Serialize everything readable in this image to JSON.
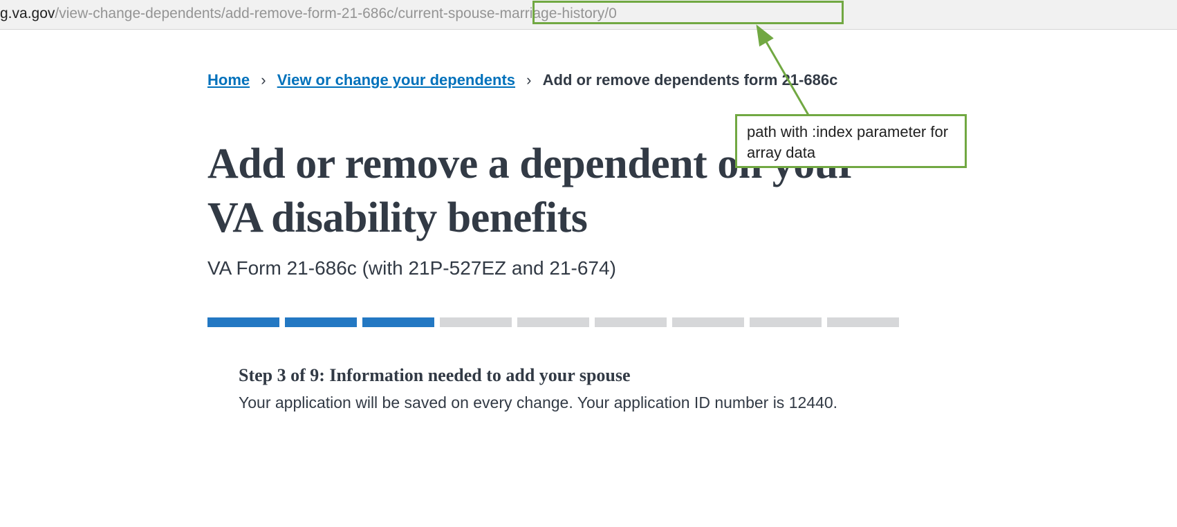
{
  "url": {
    "domain_part": "g.va.gov",
    "path_part": "/view-change-dependents/add-remove-form-21-686c/current-spouse-marriage-history/0"
  },
  "breadcrumbs": {
    "home": "Home",
    "level1": "View or change your dependents",
    "current": "Add or remove dependents form 21-686c",
    "separator": "›"
  },
  "page": {
    "title": "Add or remove a dependent on your VA disability benefits",
    "subtitle": "VA Form 21-686c (with 21P-527EZ and 21-674)"
  },
  "progress": {
    "total": 9,
    "completed": 3
  },
  "step": {
    "title": "Step 3 of 9: Information needed to add your spouse",
    "desc": "Your application will be saved on every change. Your application ID number is 12440."
  },
  "annotations": {
    "path_label": "path with :index parameter for array data"
  }
}
